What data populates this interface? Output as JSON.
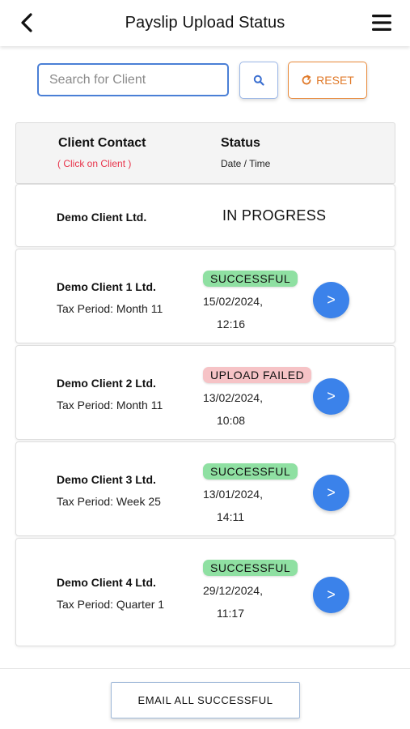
{
  "header": {
    "title": "Payslip Upload Status",
    "back_icon": "chevron-left-icon",
    "menu_icon": "hamburger-menu-icon"
  },
  "search": {
    "placeholder": "Search for Client",
    "value": "",
    "search_icon": "search-icon",
    "reset_label": "RESET",
    "reset_icon": "refresh-icon"
  },
  "table_header": {
    "client_contact": "Client Contact",
    "click_hint": "( Click on Client )",
    "status": "Status",
    "date_time": "Date / Time"
  },
  "rows": [
    {
      "client": "Demo Client Ltd.",
      "period": "",
      "status": "IN PROGRESS",
      "date": "",
      "time": ""
    },
    {
      "client": "Demo Client 1 Ltd.",
      "period": "Tax Period: Month 11",
      "status": "SUCCESSFUL",
      "date": "15/02/2024,",
      "time": "12:16",
      "action": ">"
    },
    {
      "client": "Demo Client 2 Ltd.",
      "period": "Tax Period: Month 11",
      "status": "UPLOAD FAILED",
      "date": "13/02/2024,",
      "time": "10:08",
      "action": ">"
    },
    {
      "client": "Demo Client 3 Ltd.",
      "period": "Tax Period: Week 25",
      "status": "SUCCESSFUL",
      "date": "13/01/2024,",
      "time": "14:11",
      "action": ">"
    },
    {
      "client": "Demo Client 4 Ltd.",
      "period": "Tax Period: Quarter 1",
      "status": "SUCCESSFUL",
      "date": "29/12/2024,",
      "time": "11:17",
      "action": ">"
    }
  ],
  "footer": {
    "email_button": "EMAIL ALL SUCCESSFUL"
  },
  "colors": {
    "accent_blue": "#3b82ea",
    "reset_orange": "#e07a2a",
    "success_green": "#8fe0a2",
    "failed_pink": "#f6c3c6",
    "hint_red": "#e8334a"
  }
}
